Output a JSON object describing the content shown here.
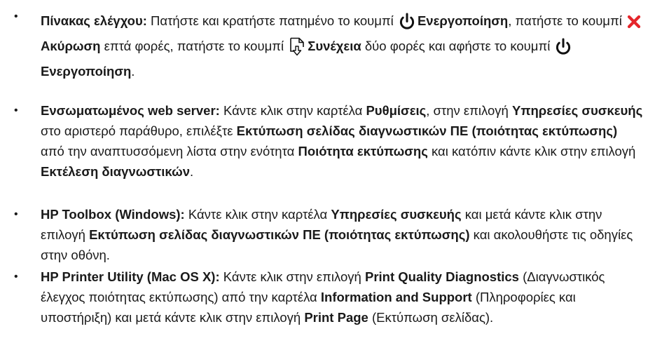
{
  "items": [
    {
      "label": "Πίνακας ελέγχου:",
      "t1": " Πατήστε και κρατήστε πατημένο το κουμπί ",
      "power_1": "Ενεργοποίηση",
      "t2": ", πατήστε το κουμπί ",
      "cancel": "Ακύρωση",
      "t3": " επτά φορές, πατήστε το κουμπί ",
      "resume": "Συνέχεια",
      "t4": " δύο φορές και αφήστε το κουμπί ",
      "power_2": "Ενεργοποίηση",
      "t5": "."
    },
    {
      "label": "Ενσωματωμένος web server:",
      "t1": " Κάντε κλικ στην καρτέλα ",
      "settings": "Ρυθμίσεις",
      "t2": ", στην επιλογή ",
      "device_services": "Υπηρεσίες συσκευής",
      "t3": " στο αριστερό παράθυρο, επιλέξτε ",
      "print_page": "Εκτύπωση σελίδας διαγνωστικών ΠΕ (ποιότητας εκτύπωσης)",
      "t4": " από την αναπτυσσόμενη λίστα στην ενότητα ",
      "print_quality": "Ποιότητα εκτύπωσης",
      "t5": " και κατόπιν κάντε κλικ στην επιλογή ",
      "run": "Εκτέλεση διαγνωστικών",
      "t6": "."
    },
    {
      "label": "HP Toolbox (Windows):",
      "t1": " Κάντε κλικ στην καρτέλα ",
      "device_services": "Υπηρεσίες συσκευής",
      "t2": " και μετά κάντε κλικ στην επιλογή ",
      "print_page": "Εκτύπωση σελίδας διαγνωστικών ΠΕ (ποιότητας εκτύπωσης)",
      "t3": " και ακολουθήστε τις οδηγίες στην οθόνη."
    },
    {
      "label": "HP Printer Utility (Mac OS X):",
      "t1": " Κάντε κλικ στην επιλογή ",
      "pqd": "Print Quality Diagnostics",
      "t2": " (Διαγνωστικός έλεγχος ποιότητας εκτύπωσης) από την καρτέλα ",
      "info": "Information and Support",
      "t3": " (Πληροφορίες και υποστήριξη) και μετά κάντε κλικ στην επιλογή ",
      "print_page": "Print Page",
      "t4": " (Εκτύπωση σελίδας)."
    }
  ],
  "bullet_char": "•",
  "icons": {
    "power": "power-icon",
    "cancel": "cancel-x-icon",
    "resume": "resume-page-icon"
  },
  "colors": {
    "cancel_red": "#e5262b",
    "text": "#1a1a1a"
  }
}
